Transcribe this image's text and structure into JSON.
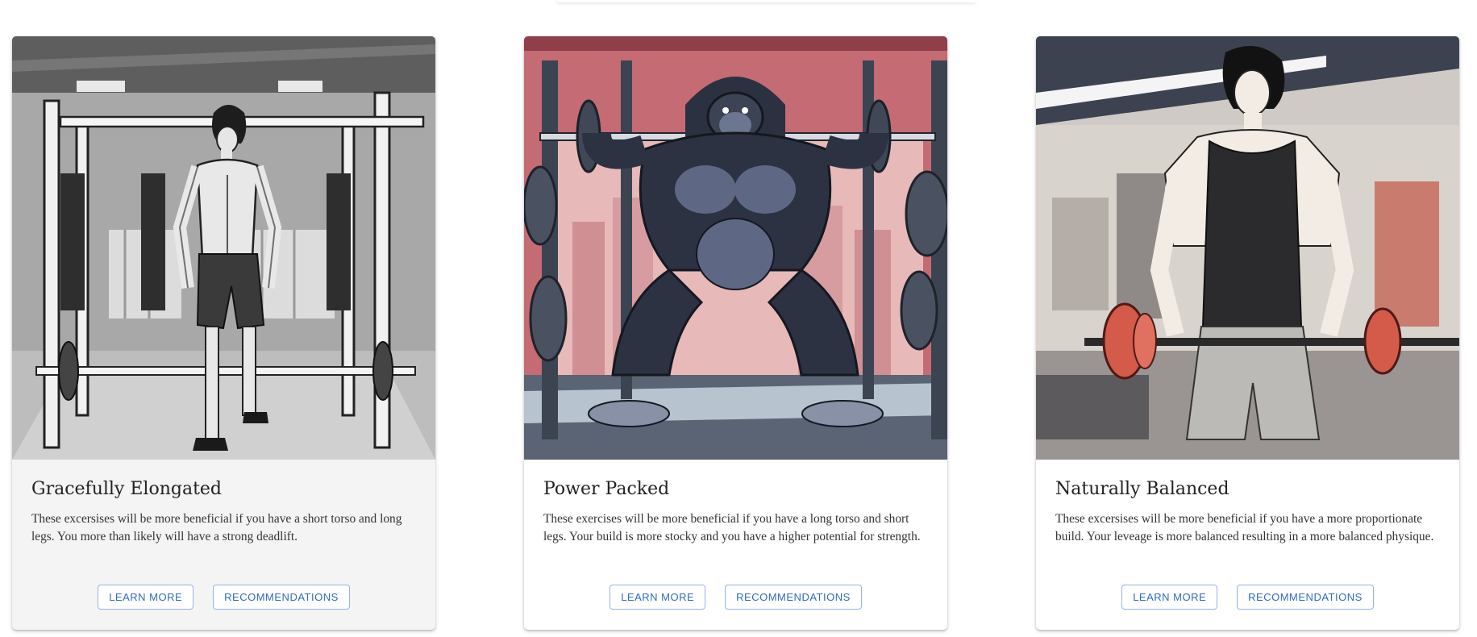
{
  "cards": [
    {
      "title": "Gracefully Elongated",
      "text": "These excersises will be more beneficial if you have a short torso and long legs. You more than likely will have a strong deadlift.",
      "image_desc": "grayscale-anime-man-at-squat-rack",
      "learn_label": "LEARN MORE",
      "rec_label": "RECOMMENDATIONS"
    },
    {
      "title": "Power Packed",
      "text": "These exercises will be more beneficial if you have a long torso and short legs. Your build is more stocky and you have a higher potential for strength.",
      "image_desc": "cartoon-gorilla-squatting-barbell",
      "learn_label": "LEARN MORE",
      "rec_label": "RECOMMENDATIONS"
    },
    {
      "title": "Naturally Balanced",
      "text": "These excersises will be more beneficial if you have a more proportionate build. Your leveage is more balanced resulting in a more balanced physique.",
      "image_desc": "anime-man-tank-top-holding-red-barbell",
      "learn_label": "LEARN MORE",
      "rec_label": "RECOMMENDATIONS"
    }
  ],
  "colors": {
    "button_text": "#2f6bc4",
    "button_border": "#94b4e3",
    "card_one_bg": "#f4f4f4",
    "card_bg": "#ffffff"
  }
}
